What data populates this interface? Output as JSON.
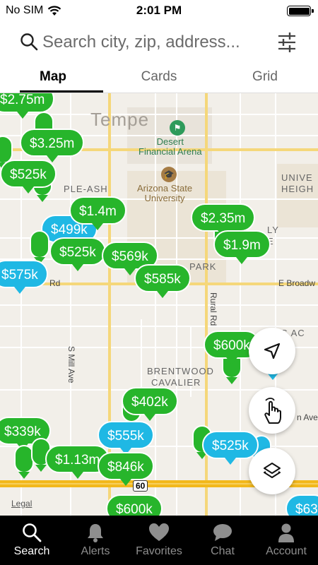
{
  "status": {
    "carrier": "No SIM",
    "time": "2:01 PM"
  },
  "search": {
    "placeholder": "Search city, zip, address..."
  },
  "tabs": [
    {
      "label": "Map",
      "active": true
    },
    {
      "label": "Cards",
      "active": false
    },
    {
      "label": "Grid",
      "active": false
    }
  ],
  "map": {
    "city_label": "Tempe",
    "poi_arena": "Desert\nFinancial Arena",
    "poi_university": "Arizona State\nUniversity",
    "neighborhood_labels": [
      "PLE-ASH",
      "UNIVE",
      "HEIGH",
      "LY",
      "E",
      "PARK",
      "BRENTWOOD",
      "CAVALIER",
      "S AC"
    ],
    "streets": [
      "E Broadw",
      "Rd",
      "S Mill Ave",
      "Rural Rd",
      "n Ave"
    ],
    "highway_shield": "60",
    "legal": "Legal",
    "pins": [
      {
        "price": "$2.75m",
        "color": "green"
      },
      {
        "price": "$3.25m",
        "color": "green"
      },
      {
        "price": "$525k",
        "color": "green"
      },
      {
        "price": "$1.4m",
        "color": "green"
      },
      {
        "price": "$499k",
        "color": "blue"
      },
      {
        "price": "$525k",
        "color": "green"
      },
      {
        "price": "$575k",
        "color": "blue"
      },
      {
        "price": "$569k",
        "color": "green"
      },
      {
        "price": "$585k",
        "color": "green"
      },
      {
        "price": "$2.35m",
        "color": "green"
      },
      {
        "price": "$1.9m",
        "color": "green"
      },
      {
        "price": "$600k",
        "color": "green"
      },
      {
        "price": "$402k",
        "color": "green"
      },
      {
        "price": "$339k",
        "color": "green"
      },
      {
        "price": "$555k",
        "color": "blue"
      },
      {
        "price": "$1.13m",
        "color": "green"
      },
      {
        "price": "$846k",
        "color": "green"
      },
      {
        "price": "$525k",
        "color": "blue"
      },
      {
        "price": "$600k",
        "color": "green"
      },
      {
        "price": "$63",
        "color": "blue"
      }
    ]
  },
  "fabs": {
    "locate": "location-arrow-icon",
    "draw": "hand-draw-icon",
    "layers": "layers-icon"
  },
  "bottom_nav": [
    {
      "label": "Search",
      "icon": "search-icon",
      "active": true
    },
    {
      "label": "Alerts",
      "icon": "bell-icon",
      "active": false
    },
    {
      "label": "Favorites",
      "icon": "heart-icon",
      "active": false
    },
    {
      "label": "Chat",
      "icon": "chat-icon",
      "active": false
    },
    {
      "label": "Account",
      "icon": "account-icon",
      "active": false
    }
  ],
  "colors": {
    "pin_green": "#27b52b",
    "pin_blue": "#1fb8e4",
    "nav_bg": "#000000"
  }
}
